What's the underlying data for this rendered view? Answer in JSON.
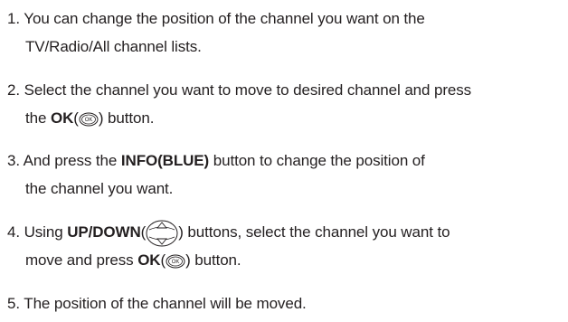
{
  "steps": [
    {
      "line1": "1. You can change the position of the channel you want on the",
      "line2": "TV/Radio/All channel lists."
    },
    {
      "line1": "2. Select the channel you want to move to desired channel and press",
      "line2_pre": "the ",
      "line2_bold": "OK",
      "line2_open": "(",
      "line2_close": ") button.",
      "icon": "ok-button-icon"
    },
    {
      "line1_pre": "3. And press the ",
      "line1_bold": "INFO(BLUE)",
      "line1_post": " button to change the position of",
      "line2": "the channel you want."
    },
    {
      "line1_pre": "4. Using ",
      "line1_bold": "UP/DOWN",
      "line1_open": "(",
      "line1_post": ") buttons, select the channel you want to",
      "line2_pre": "move and press ",
      "line2_bold": "OK",
      "line2_open": "(",
      "line2_close": ") button.",
      "icons": [
        "up-down-button-icon",
        "ok-button-icon"
      ]
    },
    {
      "line1": "5. The position of the channel will be moved."
    }
  ],
  "icon_label": "OK"
}
